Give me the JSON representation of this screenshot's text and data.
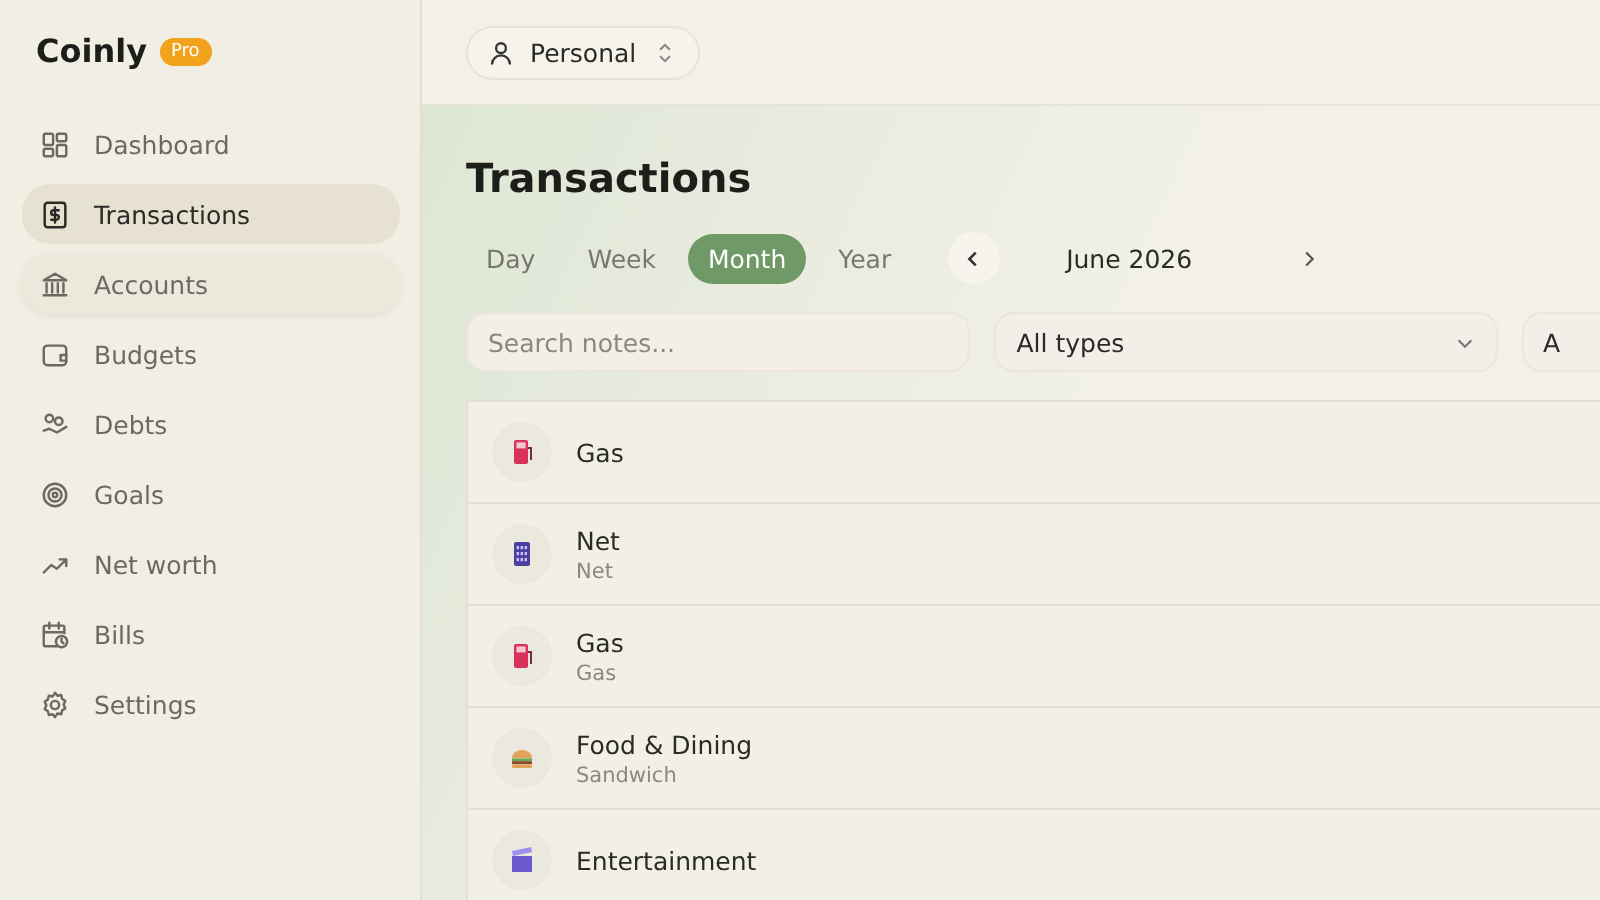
{
  "brand": {
    "name": "Coinly",
    "badge": "Pro"
  },
  "sidebar": {
    "items": [
      {
        "label": "Dashboard",
        "selected": false,
        "hovered": false
      },
      {
        "label": "Transactions",
        "selected": true,
        "hovered": false
      },
      {
        "label": "Accounts",
        "selected": false,
        "hovered": true
      },
      {
        "label": "Budgets",
        "selected": false,
        "hovered": false
      },
      {
        "label": "Debts",
        "selected": false,
        "hovered": false
      },
      {
        "label": "Goals",
        "selected": false,
        "hovered": false
      },
      {
        "label": "Net worth",
        "selected": false,
        "hovered": false
      },
      {
        "label": "Bills",
        "selected": false,
        "hovered": false
      },
      {
        "label": "Settings",
        "selected": false,
        "hovered": false
      }
    ]
  },
  "profile_selector": {
    "label": "Personal"
  },
  "page_title": "Transactions",
  "period_tabs": [
    {
      "label": "Day",
      "selected": false
    },
    {
      "label": "Week",
      "selected": false
    },
    {
      "label": "Month",
      "selected": true
    },
    {
      "label": "Year",
      "selected": false
    }
  ],
  "period": "June 2026",
  "filters": {
    "search": {
      "placeholder": "Search notes..."
    },
    "type_select": {
      "value": "All types"
    },
    "column_3": {
      "value": "A"
    }
  },
  "transactions": [
    {
      "kind": "gas",
      "title": "Gas"
    },
    {
      "kind": "grid",
      "title": "Net",
      "subtitle": "Net"
    },
    {
      "kind": "gas",
      "title": "Gas",
      "subtitle": "Gas"
    },
    {
      "kind": "food",
      "title": "Food & Dining",
      "subtitle": "Sandwich"
    },
    {
      "kind": "film",
      "title": "Entertainment"
    }
  ]
}
